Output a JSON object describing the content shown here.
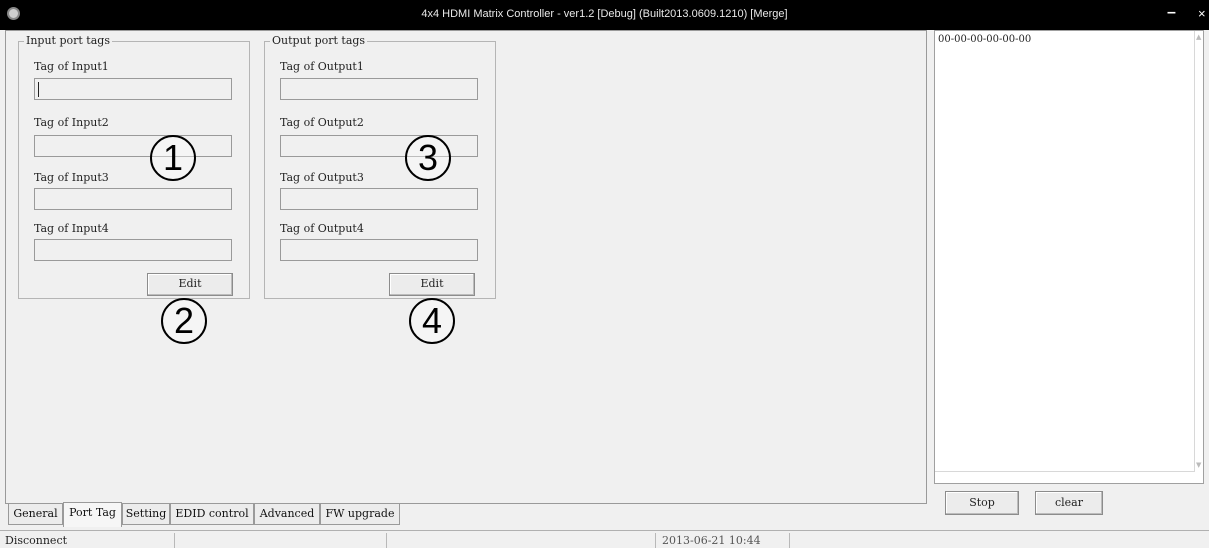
{
  "window": {
    "title": "4x4 HDMI Matrix Controller - ver1.2 [Debug]  (Built2013.0609.1210) [Merge]",
    "minimize_glyph": "–",
    "close_glyph": "×",
    "icon": "app-gear-icon"
  },
  "input_group": {
    "legend": "Input port tags",
    "labels": [
      "Tag of Input1",
      "Tag of Input2",
      "Tag of Input3",
      "Tag of Input4"
    ],
    "values": [
      "",
      "",
      "",
      ""
    ],
    "edit_label": "Edit"
  },
  "output_group": {
    "legend": "Output port tags",
    "labels": [
      "Tag of Output1",
      "Tag of Output2",
      "Tag of Output3",
      "Tag of Output4"
    ],
    "values": [
      "",
      "",
      "",
      ""
    ],
    "edit_label": "Edit"
  },
  "markers": [
    "1",
    "2",
    "3",
    "4"
  ],
  "tabs": [
    {
      "label": "General",
      "active": false
    },
    {
      "label": "Port Tag",
      "active": true
    },
    {
      "label": "Setting",
      "active": false
    },
    {
      "label": "EDID control",
      "active": false
    },
    {
      "label": "Advanced",
      "active": false
    },
    {
      "label": "FW upgrade",
      "active": false
    }
  ],
  "log": {
    "lines": [
      "00-00-00-00-00-00"
    ]
  },
  "side_buttons": {
    "stop": "Stop",
    "clear": "clear"
  },
  "status": {
    "connection": "Disconnect",
    "cell2": "",
    "cell3": "",
    "datetime": "2013-06-21 10:44",
    "cell5": ""
  }
}
